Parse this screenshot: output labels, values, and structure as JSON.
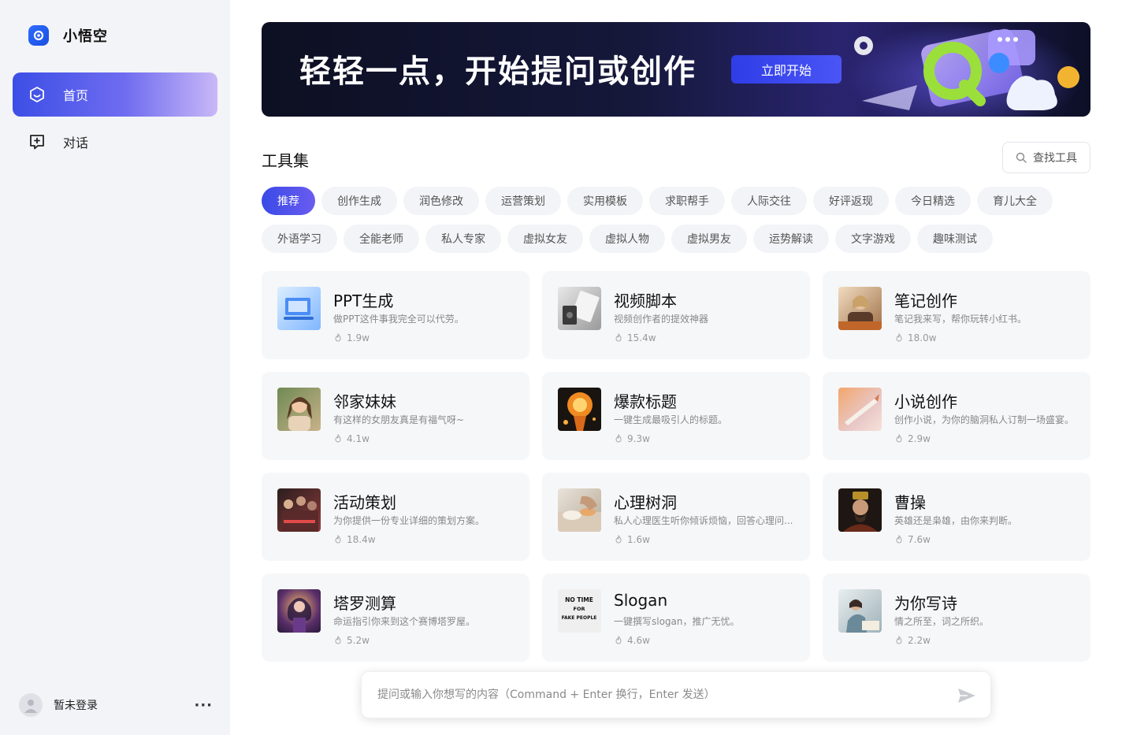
{
  "app": {
    "name": "小悟空"
  },
  "nav": {
    "items": [
      {
        "label": "首页",
        "icon": "home-hexagon-icon",
        "active": true
      },
      {
        "label": "对话",
        "icon": "chat-plus-icon",
        "active": false
      }
    ]
  },
  "user": {
    "name": "暂未登录",
    "more": "···"
  },
  "banner": {
    "title": "轻轻一点，开始提问或创作",
    "button": "立即开始"
  },
  "tools": {
    "title": "工具集",
    "search_label": "查找工具",
    "tags": [
      "推荐",
      "创作生成",
      "润色修改",
      "运营策划",
      "实用模板",
      "求职帮手",
      "人际交往",
      "好评返现",
      "今日精选",
      "育儿大全",
      "外语学习",
      "全能老师",
      "私人专家",
      "虚拟女友",
      "虚拟人物",
      "虚拟男友",
      "运势解读",
      "文字游戏",
      "趣味测试"
    ],
    "active_tag": "推荐",
    "cards": [
      {
        "title": "PPT生成",
        "desc": "做PPT这件事我完全可以代劳。",
        "count": "1.9w"
      },
      {
        "title": "视频脚本",
        "desc": "视频创作者的提效神器",
        "count": "15.4w"
      },
      {
        "title": "笔记创作",
        "desc": "笔记我来写，帮你玩转小红书。",
        "count": "18.0w"
      },
      {
        "title": "邻家妹妹",
        "desc": "有这样的女朋友真是有福气呀~",
        "count": "4.1w"
      },
      {
        "title": "爆款标题",
        "desc": "一键生成最吸引人的标题。",
        "count": "9.3w"
      },
      {
        "title": "小说创作",
        "desc": "创作小说，为你的脑洞私人订制一场盛宴。",
        "count": "2.9w"
      },
      {
        "title": "活动策划",
        "desc": "为你提供一份专业详细的策划方案。",
        "count": "18.4w"
      },
      {
        "title": "心理树洞",
        "desc": "私人心理医生听你倾诉烦恼，回答心理问...",
        "count": "1.6w"
      },
      {
        "title": "曹操",
        "desc": "英雄还是枭雄，由你来判断。",
        "count": "7.6w"
      },
      {
        "title": "塔罗测算",
        "desc": "命运指引你来到这个赛博塔罗屋。",
        "count": "5.2w"
      },
      {
        "title": "Slogan",
        "desc": "一键撰写slogan，推广无忧。",
        "count": "4.6w"
      },
      {
        "title": "为你写诗",
        "desc": "情之所至，词之所织。",
        "count": "2.2w"
      }
    ]
  },
  "slogan_thumb_text": [
    "NO TIME",
    "FOR",
    "FAKE PEOPLE"
  ],
  "composer": {
    "placeholder": "提问或输入你想写的内容（Command + Enter 换行，Enter 发送）"
  },
  "colors": {
    "accent": "#3a4ae6",
    "sidebar_bg": "#f3f4f7",
    "card_bg": "#f6f7f9"
  }
}
